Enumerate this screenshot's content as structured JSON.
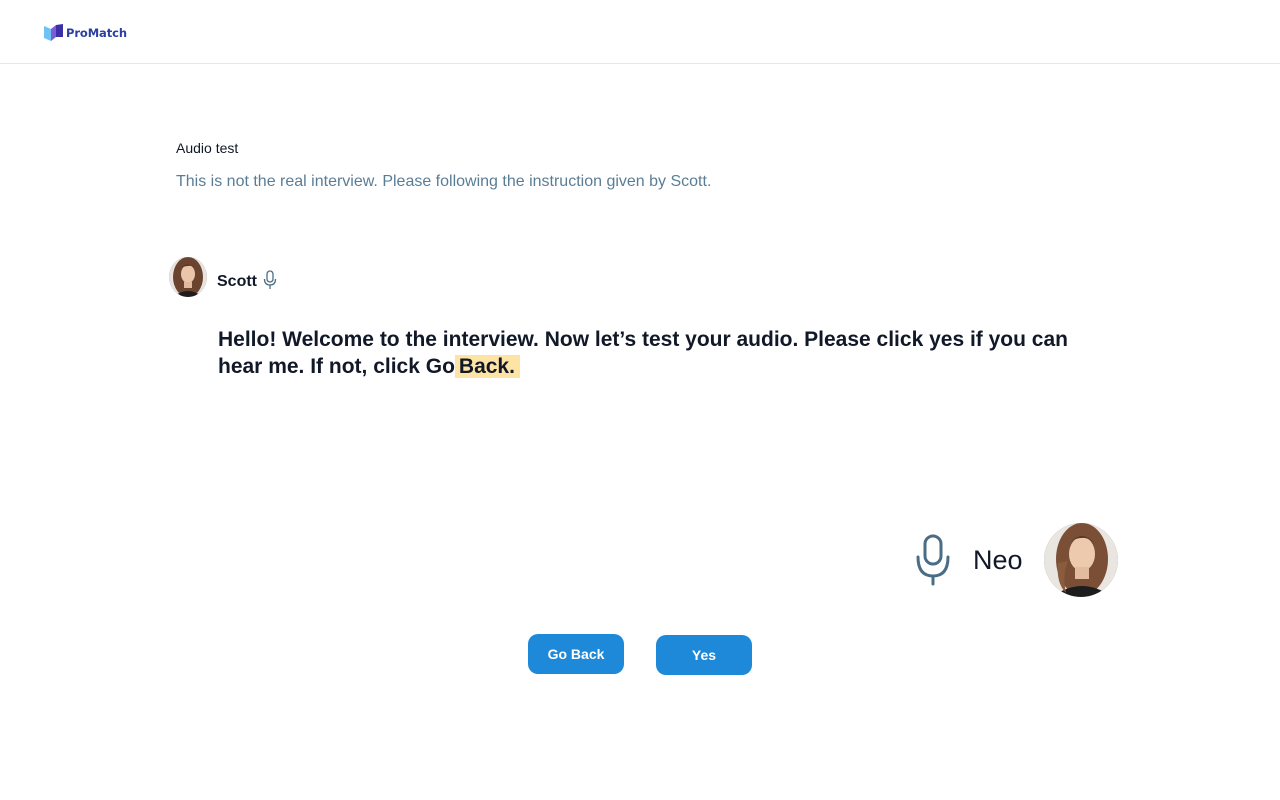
{
  "header": {
    "brand_name": "ProMatch",
    "logo_colors": [
      "#6ec3f4",
      "#7b5bd6",
      "#3d2fa8"
    ]
  },
  "test": {
    "title": "Audio test",
    "subtitle": "This is not the real interview. Please following the instruction given by Scott."
  },
  "interviewer": {
    "name": "Scott",
    "icon": "microphone-icon",
    "message_text": "Hello! Welcome to the interview. Now let’s test your audio. Please click yes if you can hear me. If not, click Go",
    "message_highlight": "Back."
  },
  "candidate": {
    "name": "Neo",
    "icon": "microphone-icon"
  },
  "actions": {
    "go_back_label": "Go Back",
    "yes_label": "Yes"
  },
  "colors": {
    "primary_button": "#1e88d9",
    "highlight": "#fde4a5",
    "subtitle_text": "#5a7d96",
    "mic_icon": "#4a6d86"
  }
}
